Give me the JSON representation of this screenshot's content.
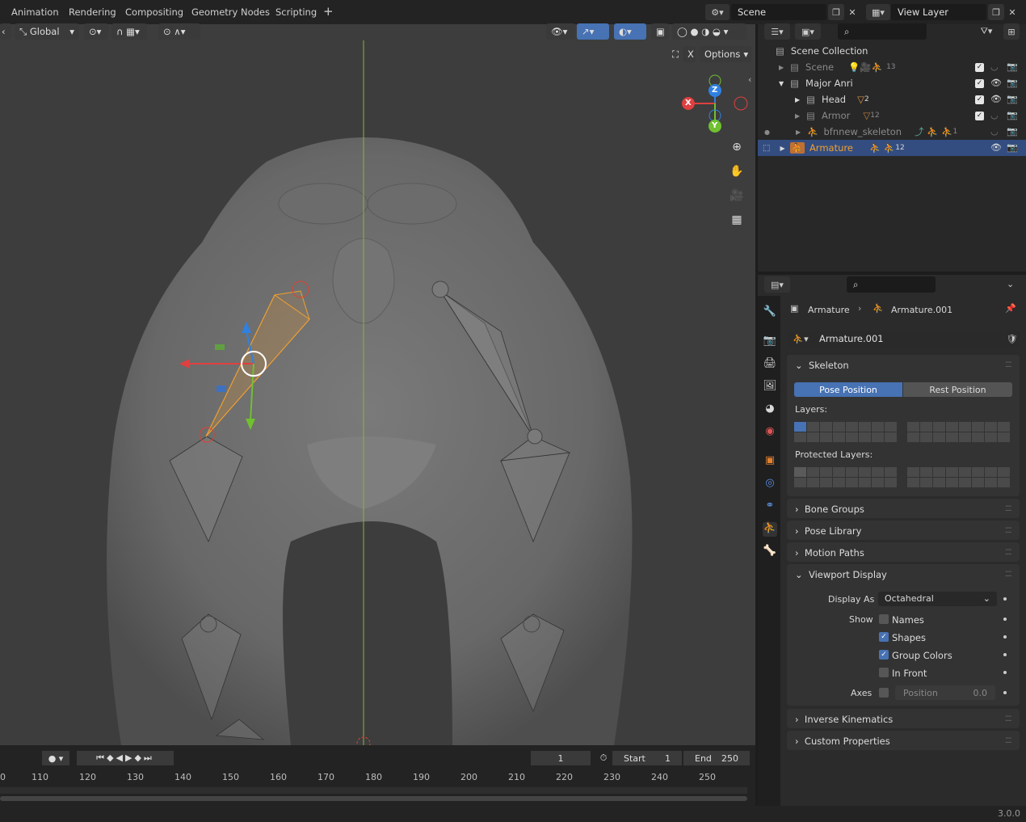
{
  "topbar": {
    "tabs": [
      "Animation",
      "Rendering",
      "Compositing",
      "Geometry Nodes",
      "Scripting"
    ],
    "add_tab": "+",
    "scene": "Scene",
    "view_layer": "View Layer"
  },
  "viewport_header": {
    "orientation": "Global",
    "options": "Options",
    "x_label": "X"
  },
  "gizmo": {
    "x": "X",
    "y": "Y",
    "z": "Z"
  },
  "outliner": {
    "scene_collection": "Scene Collection",
    "rows": [
      {
        "name": "Scene",
        "badge": "13"
      },
      {
        "name": "Major Anri"
      },
      {
        "name": "Head",
        "badge": "2"
      },
      {
        "name": "Armor",
        "badge": "12"
      },
      {
        "name": "bfnnew_skeleton",
        "badge": "1"
      },
      {
        "name": "Armature",
        "badge": "12"
      }
    ]
  },
  "properties": {
    "breadcrumb_object": "Armature",
    "breadcrumb_data": "Armature.001",
    "data_name": "Armature.001",
    "skeleton": {
      "title": "Skeleton",
      "pose_position": "Pose Position",
      "rest_position": "Rest Position",
      "layers_label": "Layers:",
      "protected_label": "Protected Layers:"
    },
    "panels": [
      "Bone Groups",
      "Pose Library",
      "Motion Paths"
    ],
    "viewport_display": {
      "title": "Viewport Display",
      "display_as_label": "Display As",
      "display_as_value": "Octahedral",
      "show_label": "Show",
      "names": "Names",
      "shapes": "Shapes",
      "group_colors": "Group Colors",
      "in_front": "In Front",
      "axes_label": "Axes",
      "position_label": "Position",
      "position_value": "0.0"
    },
    "bottom_panels": [
      "Inverse Kinematics",
      "Custom Properties"
    ]
  },
  "timeline": {
    "current_frame": "1",
    "start_label": "Start",
    "start_value": "1",
    "end_label": "End",
    "end_value": "250",
    "ticks": [
      "0",
      "110",
      "120",
      "130",
      "140",
      "150",
      "160",
      "170",
      "180",
      "190",
      "200",
      "210",
      "220",
      "230",
      "240",
      "250"
    ]
  },
  "status": {
    "version": "3.0.0"
  },
  "colors": {
    "accent": "#4772b3",
    "selected_row": "#334d80",
    "bone_selected": "#f0a030"
  }
}
